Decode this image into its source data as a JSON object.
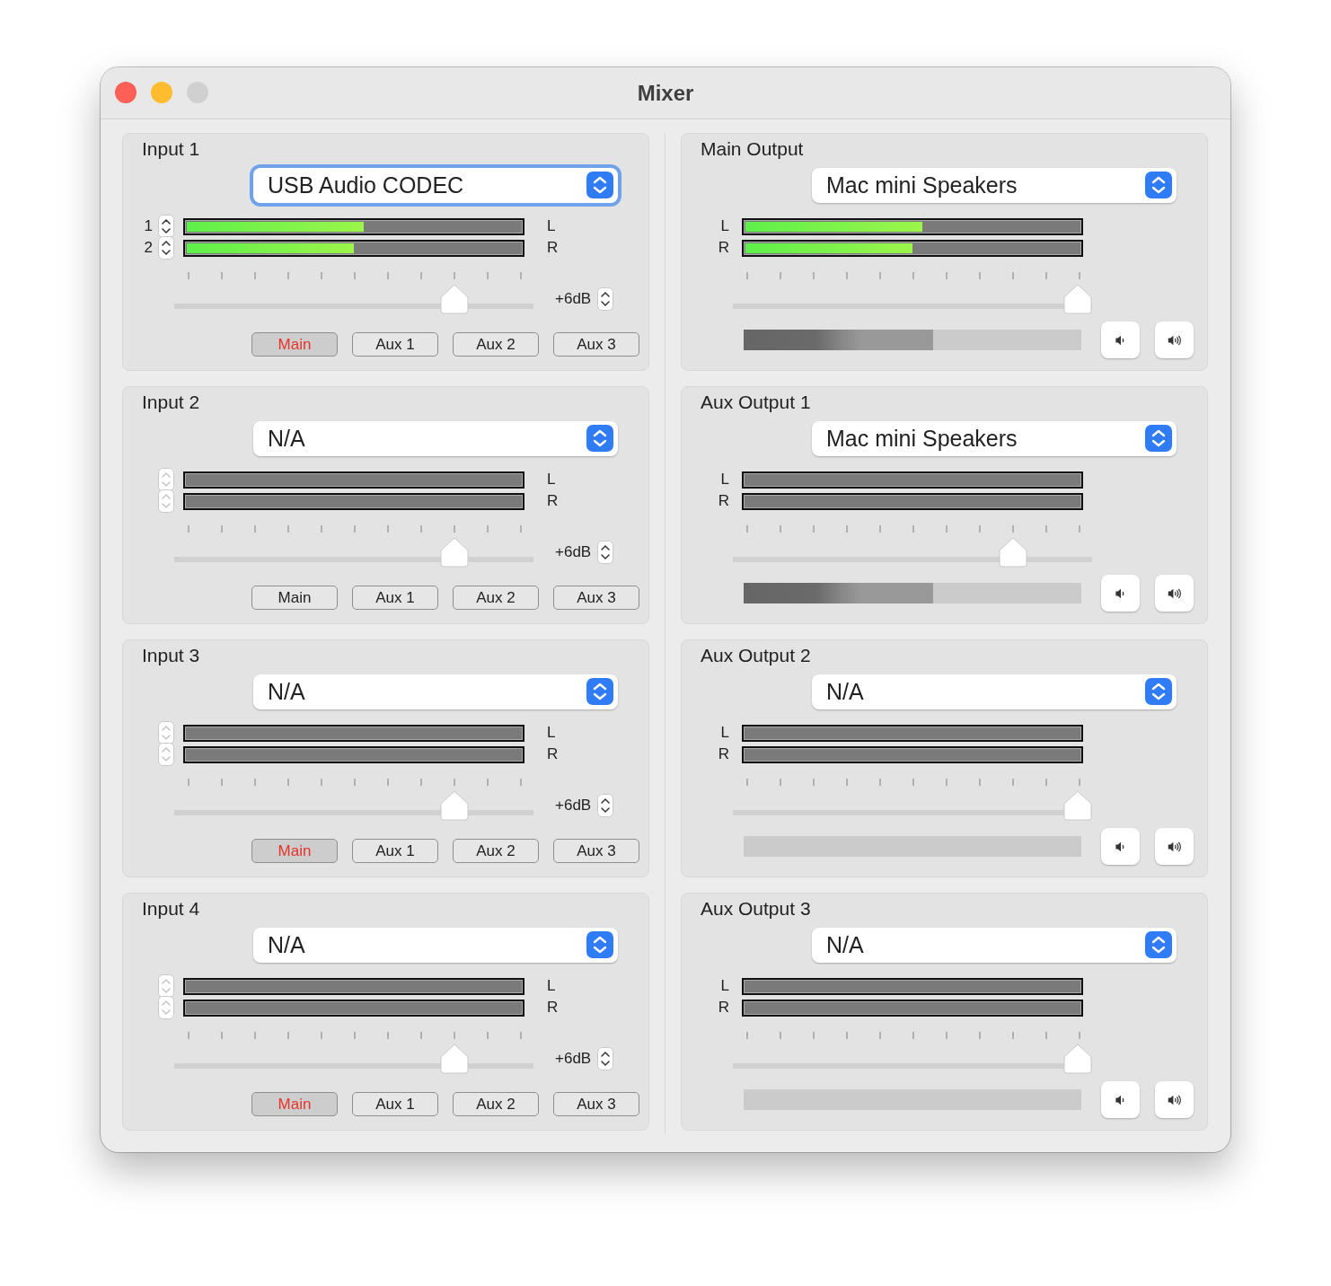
{
  "window": {
    "title": "Mixer"
  },
  "inputs": [
    {
      "title": "Input 1",
      "device": {
        "value": "USB Audio CODEC",
        "focused": true
      },
      "channels": [
        {
          "number": "1",
          "stepper_disabled": false,
          "side": "L",
          "level": 0.53
        },
        {
          "number": "2",
          "stepper_disabled": false,
          "side": "R",
          "level": 0.5
        }
      ],
      "fader": {
        "level": 0.78
      },
      "gain": "+6dB",
      "routes": [
        {
          "label": "Main",
          "selected": true
        },
        {
          "label": "Aux 1",
          "selected": false
        },
        {
          "label": "Aux 2",
          "selected": false
        },
        {
          "label": "Aux 3",
          "selected": false
        }
      ]
    },
    {
      "title": "Input 2",
      "device": {
        "value": "N/A",
        "focused": false
      },
      "channels": [
        {
          "stepper_disabled": true,
          "side": "L"
        },
        {
          "stepper_disabled": true,
          "side": "R"
        }
      ],
      "fader": {
        "level": 0.78
      },
      "gain": "+6dB",
      "routes": [
        {
          "label": "Main",
          "selected": false
        },
        {
          "label": "Aux 1",
          "selected": false
        },
        {
          "label": "Aux 2",
          "selected": false
        },
        {
          "label": "Aux 3",
          "selected": false
        }
      ]
    },
    {
      "title": "Input 3",
      "device": {
        "value": "N/A",
        "focused": false
      },
      "channels": [
        {
          "stepper_disabled": true,
          "side": "L"
        },
        {
          "stepper_disabled": true,
          "side": "R"
        }
      ],
      "fader": {
        "level": 0.78
      },
      "gain": "+6dB",
      "routes": [
        {
          "label": "Main",
          "selected": true
        },
        {
          "label": "Aux 1",
          "selected": false
        },
        {
          "label": "Aux 2",
          "selected": false
        },
        {
          "label": "Aux 3",
          "selected": false
        }
      ]
    },
    {
      "title": "Input 4",
      "device": {
        "value": "N/A",
        "focused": false
      },
      "channels": [
        {
          "stepper_disabled": true,
          "side": "L"
        },
        {
          "stepper_disabled": true,
          "side": "R"
        }
      ],
      "fader": {
        "level": 0.78
      },
      "gain": "+6dB",
      "routes": [
        {
          "label": "Main",
          "selected": true
        },
        {
          "label": "Aux 1",
          "selected": false
        },
        {
          "label": "Aux 2",
          "selected": false
        },
        {
          "label": "Aux 3",
          "selected": false
        }
      ]
    }
  ],
  "outputs": [
    {
      "title": "Main Output",
      "device": {
        "value": "Mac mini Speakers",
        "focused": false
      },
      "channels": [
        {
          "side": "L",
          "level": 0.53
        },
        {
          "side": "R",
          "level": 0.5
        }
      ],
      "fader": {
        "level": 0.96
      },
      "output_level": {
        "level": 0.56
      }
    },
    {
      "title": "Aux Output 1",
      "device": {
        "value": "Mac mini Speakers",
        "focused": false
      },
      "channels": [
        {
          "side": "L"
        },
        {
          "side": "R"
        }
      ],
      "fader": {
        "level": 0.78
      },
      "output_level": {
        "level": 0.56
      }
    },
    {
      "title": "Aux Output 2",
      "device": {
        "value": "N/A",
        "focused": false
      },
      "channels": [
        {
          "side": "L"
        },
        {
          "side": "R"
        }
      ],
      "fader": {
        "level": 0.96
      }
    },
    {
      "title": "Aux Output 3",
      "device": {
        "value": "N/A",
        "focused": false
      },
      "channels": [
        {
          "side": "L"
        },
        {
          "side": "R"
        }
      ],
      "fader": {
        "level": 0.96
      }
    }
  ]
}
